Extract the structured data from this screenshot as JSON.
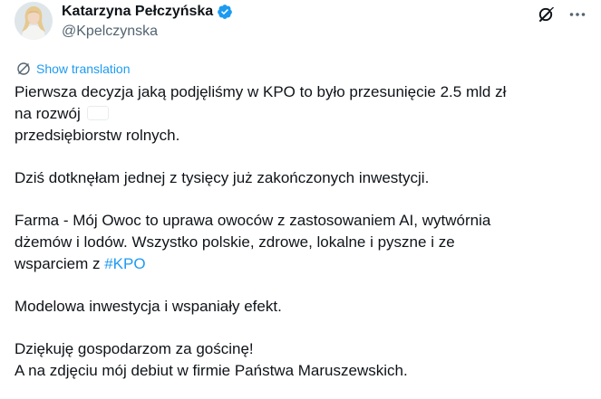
{
  "author": {
    "display_name": "Katarzyna Pełczyńska",
    "handle": "@Kpelczynska",
    "verified": true
  },
  "icons": {
    "verified": "verified-badge-icon",
    "grok": "grok-icon",
    "more": "more-dots-icon",
    "translate": "globe-translate-icon",
    "flag": "poland-flag-emoji"
  },
  "translate": {
    "label": "Show translation"
  },
  "tweet": {
    "line1": "Pierwsza decyzja jaką podjęliśmy w KPO to było przesunięcie 2.5 mld zł",
    "line2_before": "na rozwój",
    "line2_after": "przedsiębiorstw rolnych.",
    "line3": "Dziś dotknęłam jednej z tysięcy już zakończonych inwestycji.",
    "line4": "Farma - Mój Owoc to uprawa owoców z zastosowaniem AI, wytwórnia",
    "line5": "dżemów i lodów. Wszystko polskie, zdrowe, lokalne i pyszne i ze",
    "line6_before": "wsparciem z ",
    "hashtag": "#KPO",
    "line7": "Modelowa inwestycja i wspaniały efekt.",
    "line8": "Dziękuję gospodarzom za gościnę!",
    "line9": "A na zdjęciu mój debiut w firmie Państwa Maruszewskich."
  },
  "colors": {
    "link": "#1d9bf0",
    "secondary_text": "#536471",
    "primary_text": "#0f1419",
    "verified": "#1d9bf0"
  }
}
